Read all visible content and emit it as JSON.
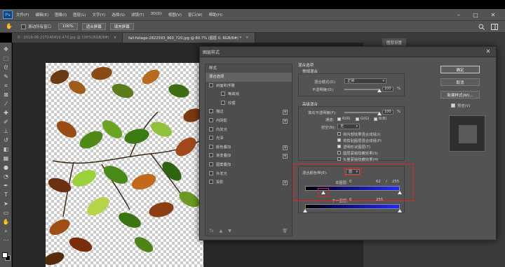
{
  "app": {
    "logo": "Ps"
  },
  "menu": [
    "文件(F)",
    "编辑(E)",
    "图像(I)",
    "图层(L)",
    "文字(Y)",
    "选择(S)",
    "滤镜(T)",
    "3D(D)",
    "视图(V)",
    "窗口(W)",
    "帮助(H)"
  ],
  "options_bar": {
    "scroll_all_label": "滚动所有窗口",
    "zoom": "100%",
    "fit_screen": "适合屏幕",
    "fill_screen": "填充屏幕"
  },
  "tabs": [
    {
      "label": "0 - 2019-06-21T140419.470.jpg @ 100%(RGB/8#)",
      "active": false
    },
    {
      "label": "fall-foliage-2822593_960_720.jpg @ 80.7% (图层 0, RGB/8#) *",
      "active": true
    }
  ],
  "panel": {
    "tab_label": "图层设置"
  },
  "dialog": {
    "title": "图层样式",
    "style_list": {
      "header": "样式",
      "items": [
        {
          "label": "混合选项",
          "selected": true,
          "checkbox": false,
          "plus": false,
          "sub": false
        },
        {
          "label": "斜面和浮雕",
          "checkbox": true,
          "checked": false,
          "plus": false,
          "sub": false
        },
        {
          "label": "等高线",
          "checkbox": true,
          "checked": false,
          "plus": false,
          "sub": true
        },
        {
          "label": "纹理",
          "checkbox": true,
          "checked": false,
          "plus": false,
          "sub": true
        },
        {
          "label": "描边",
          "checkbox": true,
          "checked": false,
          "plus": true,
          "sub": false
        },
        {
          "label": "内阴影",
          "checkbox": true,
          "checked": false,
          "plus": true,
          "sub": false
        },
        {
          "label": "内发光",
          "checkbox": true,
          "checked": false,
          "plus": false,
          "sub": false
        },
        {
          "label": "光泽",
          "checkbox": true,
          "checked": false,
          "plus": false,
          "sub": false
        },
        {
          "label": "颜色叠加",
          "checkbox": true,
          "checked": false,
          "plus": true,
          "sub": false
        },
        {
          "label": "渐变叠加",
          "checkbox": true,
          "checked": false,
          "plus": true,
          "sub": false
        },
        {
          "label": "图案叠加",
          "checkbox": true,
          "checked": false,
          "plus": false,
          "sub": false
        },
        {
          "label": "外发光",
          "checkbox": true,
          "checked": false,
          "plus": false,
          "sub": false
        },
        {
          "label": "投影",
          "checkbox": true,
          "checked": false,
          "plus": true,
          "sub": false
        }
      ],
      "footer_fx": "fx"
    },
    "blend_options": {
      "section_title": "混合选项",
      "general_title": "常规混合",
      "blend_mode_label": "混合模式(D):",
      "blend_mode_value": "正常",
      "opacity_label": "不透明度(O):",
      "opacity_value": "100",
      "opacity_unit": "%",
      "advanced_title": "高级混合",
      "fill_opacity_label": "填充不透明度(F):",
      "fill_opacity_value": "100",
      "fill_opacity_unit": "%",
      "channels_label": "通道:",
      "channel_r": "R(R)",
      "channel_g": "G(G)",
      "channel_b": "B(B)",
      "knockout_label": "挖空(N):",
      "knockout_value": "无",
      "options": [
        {
          "label": "将内部效果混合成组(I)",
          "checked": false
        },
        {
          "label": "将剪贴图层混合成组(P)",
          "checked": true
        },
        {
          "label": "透明形状图层(T)",
          "checked": true
        },
        {
          "label": "图层蒙版隐藏效果(S)",
          "checked": false
        },
        {
          "label": "矢量蒙版隐藏效果(H)",
          "checked": false
        }
      ],
      "blend_if_label": "混合颜色带(E):",
      "blend_if_value": "蓝",
      "this_layer_label": "本图层:",
      "this_layer_min": "0",
      "this_layer_split": "62",
      "this_layer_sep": "/",
      "this_layer_max": "255",
      "underlying_label": "下一图层:",
      "underlying_min": "0",
      "underlying_max": "255"
    },
    "buttons": {
      "ok": "确定",
      "cancel": "取消",
      "new_style": "新建样式(W)...",
      "preview": "预览(V)"
    }
  },
  "colors": {
    "accent_red": "#e0242a",
    "blue_band": "#1f2bff"
  }
}
